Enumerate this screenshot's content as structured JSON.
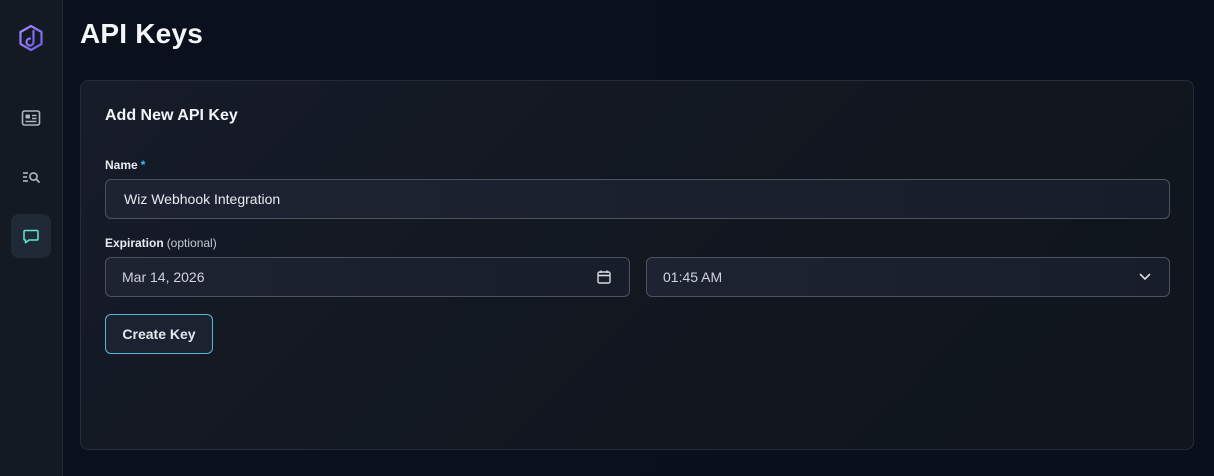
{
  "page": {
    "title": "API Keys"
  },
  "sidebar": {
    "items": [
      {
        "icon": "id-card-icon"
      },
      {
        "icon": "search-list-icon"
      },
      {
        "icon": "chat-icon",
        "active": true
      }
    ]
  },
  "form": {
    "title": "Add New API Key",
    "name": {
      "label": "Name",
      "required_marker": "*",
      "value": "Wiz Webhook Integration"
    },
    "expiration": {
      "label": "Expiration",
      "optional_text": "(optional)",
      "date_value": "Mar 14, 2026",
      "time_value": "01:45 AM"
    },
    "submit_label": "Create Key"
  },
  "colors": {
    "accent": "#38bdf8",
    "logo": "#8b7cf6",
    "active_nav_icon": "#5eead4"
  }
}
